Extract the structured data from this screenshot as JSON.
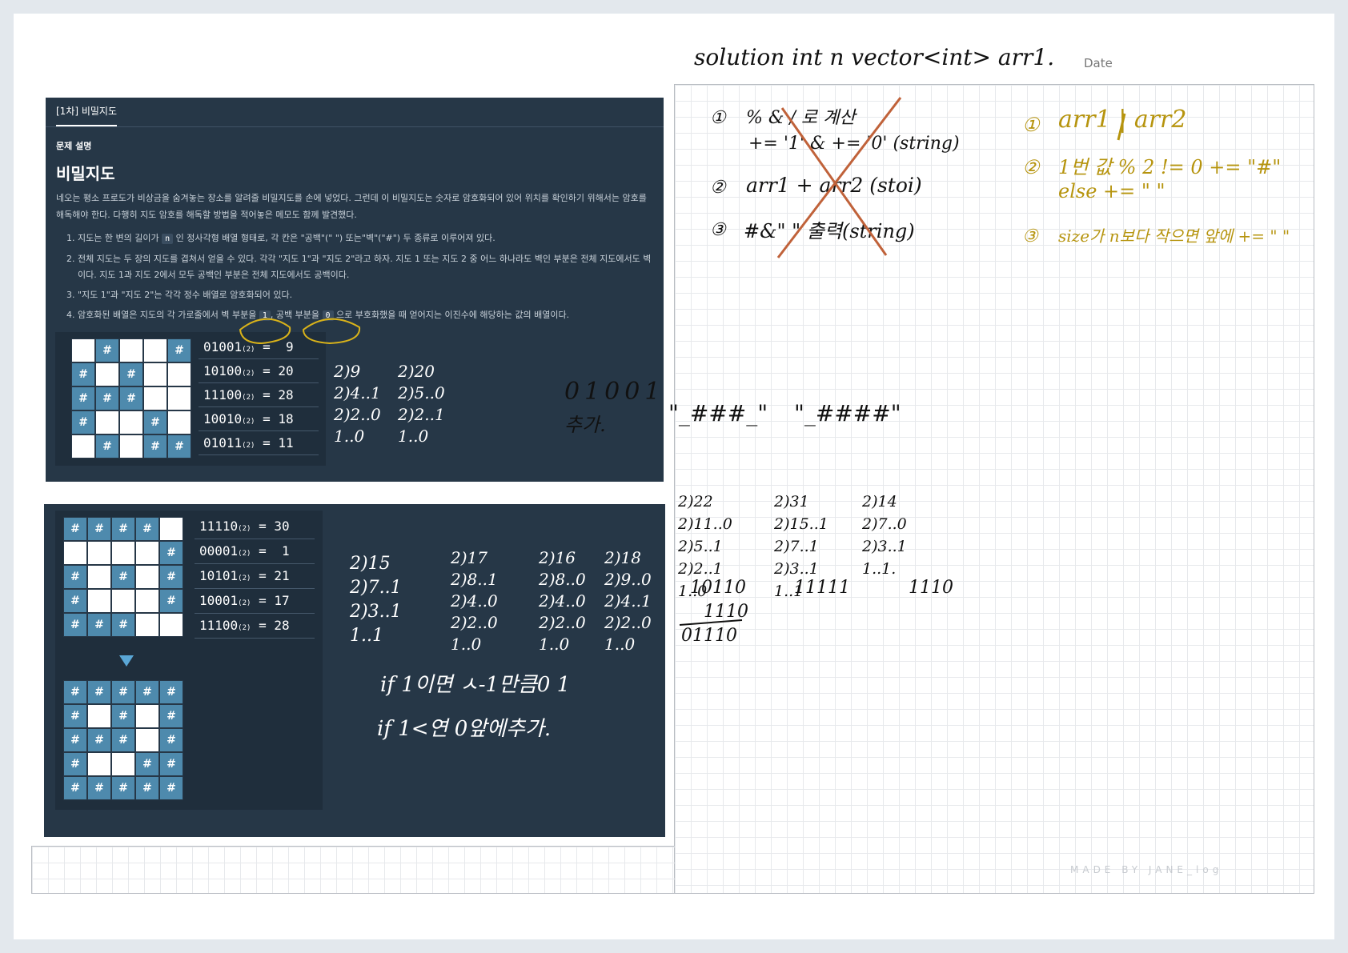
{
  "notes": {
    "header": "solution int n vector<int> arr1.",
    "date_label": "Date",
    "footer": "MADE BY JANE_log",
    "crossed_plan": {
      "step1_num": "①",
      "step1_line1": "% & / 로 계산",
      "step1_line2": "+= '1' & += '0' (string)",
      "step2_num": "②",
      "step2_line": "arr1 + arr2 (stoi)",
      "step3_num": "③",
      "step3_line": "#&\" \" 출력(string)"
    },
    "gold_plan": {
      "step1_num": "①",
      "step1": "arr1 | arr2",
      "step2_num": "②",
      "step2_line1": "1번 값 % 2 != 0 += \"#\"",
      "step2_line2": "else += \" \"",
      "step3_num": "③",
      "step3": "size가 n보다 작으면 앞에 += \" \""
    },
    "side_note_bin": "01001",
    "side_note_add": "추가.",
    "string_a": "\"_###_\"",
    "string_b": "\"_####\"",
    "div_block_1": [
      "2)22",
      "2)11..0",
      "2)5..1",
      "2)2..1",
      "1..0"
    ],
    "div_block_2": [
      "2)31",
      "2)15..1",
      "2)7..1",
      "2)3..1",
      "1..1"
    ],
    "div_block_3": [
      "2)14",
      "2)7..0",
      "2)3..1",
      "1..1."
    ],
    "result_1": "10110",
    "result_2": "11111",
    "result_3": "1110",
    "sum_line": "1110",
    "sum_result": "01110",
    "top_div_9": [
      "2)9",
      "2)4..1",
      "2)2..0",
      "1..0"
    ],
    "top_div_20": [
      "2)20",
      "2)5..0",
      "2)2..1",
      "1..0"
    ],
    "bottom_div_15": [
      "2)15",
      "2)7..1",
      "2)3..1",
      "1..1"
    ],
    "bottom_div_17": [
      "2)17",
      "2)8..1",
      "2)4..0",
      "2)2..0",
      "1..0"
    ],
    "bottom_div_16": [
      "2)16",
      "2)8..0",
      "2)4..0",
      "2)2..0",
      "1..0"
    ],
    "bottom_div_18": [
      "2)18",
      "2)9..0",
      "2)4..1",
      "2)2..0",
      "1..0"
    ],
    "if_line_1": "if 1이면 ㅅ-1만큼0 1",
    "if_line_2": "if 1<연 0앞에추가."
  },
  "problem": {
    "tab": "[1차] 비밀지도",
    "section_label": "문제 설명",
    "title": "비밀지도",
    "description": "네오는 평소 프로도가 비상금을 숨겨놓는 장소를 알려줄 비밀지도를 손에 넣었다. 그런데 이 비밀지도는 숫자로 암호화되어 있어 위치를 확인하기 위해서는 암호를 해독해야 한다. 다행히 지도 암호를 해독할 방법을 적어놓은 메모도 함께 발견했다.",
    "items": [
      {
        "pre": "1. 지도는 한 변의 길이가 ",
        "code": "n",
        "post": " 인 정사각형 배열 형태로, 각 칸은 \"공백\"(\" \") 또는\"벽\"(\"#\") 두 종류로 이루어져 있다."
      },
      {
        "pre": "2. 전체 지도는 두 장의 지도를 겹쳐서 얻을 수 있다. 각각 \"지도 1\"과 \"지도 2\"라고 하자. 지도 1 또는 지도 2 중 어느 하나라도 벽인 부분은 전체 지도에서도 벽이다. 지도 1과 지도 2에서 모두 공백인 부분은 전체 지도에서도 공백이다.",
        "code": "",
        "post": ""
      },
      {
        "pre": "3. \"지도 1\"과 \"지도 2\"는 각각 정수 배열로 암호화되어 있다.",
        "code": "",
        "post": ""
      },
      {
        "pre": "4. 암호화된 배열은 지도의 각 가로줄에서 벽 부분을 ",
        "code": "1",
        "mid": ", 공백 부분을 ",
        "code2": "0",
        "post": " 으로 부호화했을 때 얻어지는 이진수에 해당하는 값의 배열이다."
      }
    ],
    "wall_symbol": "#",
    "map1": {
      "rows": [
        "01001",
        "10100",
        "11100",
        "10010",
        "01011"
      ],
      "equations": [
        "01001",
        "10100",
        "11100",
        "10010",
        "01011"
      ],
      "values": [
        "9",
        "20",
        "28",
        "18",
        "11"
      ]
    },
    "map2": {
      "rows": [
        "11110",
        "00001",
        "10101",
        "10001",
        "11100"
      ],
      "equations": [
        "11110",
        "00001",
        "10101",
        "10001",
        "11100"
      ],
      "values": [
        "30",
        "1",
        "21",
        "17",
        "28"
      ]
    },
    "combined": [
      "11111",
      "10101",
      "11101",
      "10011",
      "11111"
    ],
    "subscript": "(2)",
    "equals": "="
  },
  "colors": {
    "panel": "#263747",
    "wall": "#4e8aad",
    "ink_gold": "#b6940e",
    "strike": "#c0623a",
    "arrow": "#5aa7d6"
  }
}
